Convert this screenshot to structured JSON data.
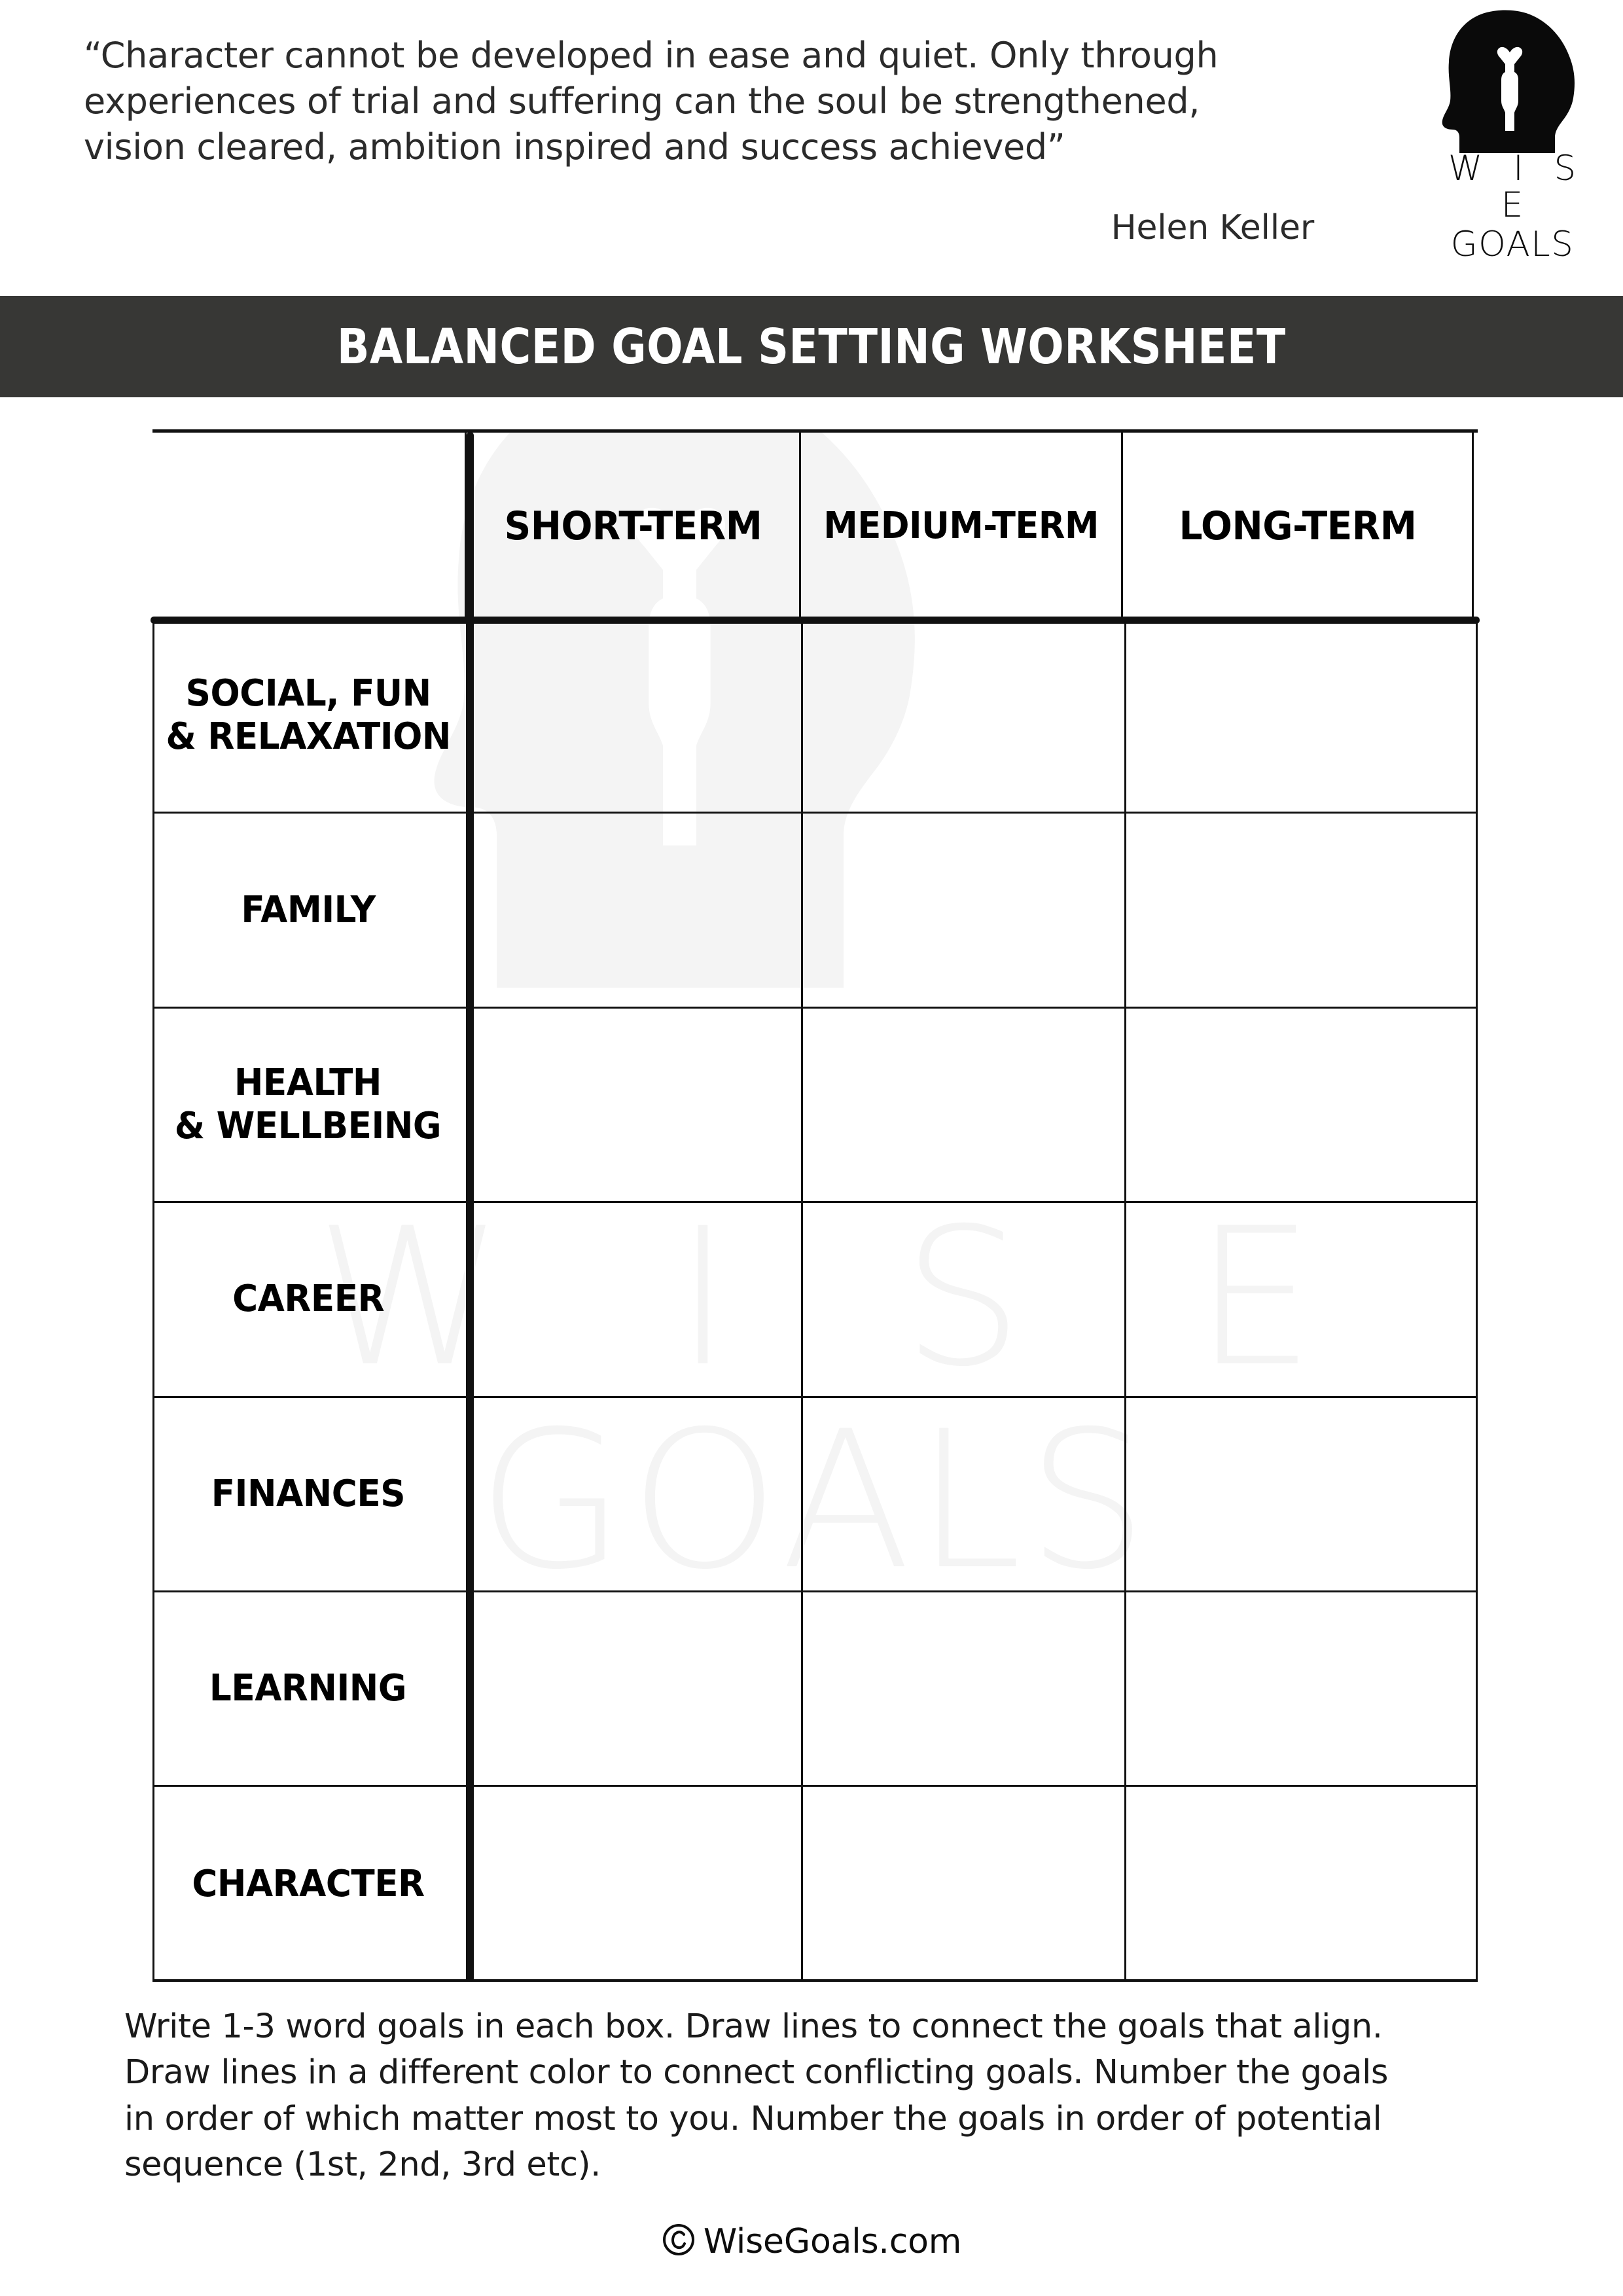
{
  "quote": {
    "text": "“Character cannot be developed in ease and quiet. Only through\nexperiences of trial and suffering can the soul be strengthened,\nvision cleared, ambition inspired and success achieved”",
    "attribution": "Helen Keller"
  },
  "logo": {
    "mark_name": "head-silhouette-with-figure",
    "line1": "W I S E",
    "line2": "GOALS"
  },
  "title_bar": {
    "title": "BALANCED GOAL SETTING WORKSHEET",
    "background": "#373735",
    "text_color": "#ffffff"
  },
  "watermark": {
    "line1": "W I S E",
    "line2": "GOALS",
    "color": "#f4f4f4"
  },
  "table": {
    "corner_label": "",
    "columns": [
      "SHORT-TERM",
      "MEDIUM-TERM",
      "LONG-TERM"
    ],
    "rows": [
      {
        "label": "SOCIAL, FUN\n& RELAXATION",
        "cells": [
          "",
          "",
          ""
        ]
      },
      {
        "label": "FAMILY",
        "cells": [
          "",
          "",
          ""
        ]
      },
      {
        "label": "HEALTH\n& WELLBEING",
        "cells": [
          "",
          "",
          ""
        ]
      },
      {
        "label": "CAREER",
        "cells": [
          "",
          "",
          ""
        ]
      },
      {
        "label": "FINANCES",
        "cells": [
          "",
          "",
          ""
        ]
      },
      {
        "label": "LEARNING",
        "cells": [
          "",
          "",
          ""
        ]
      },
      {
        "label": "CHARACTER",
        "cells": [
          "",
          "",
          ""
        ]
      }
    ]
  },
  "instructions": {
    "text": "Write 1-3 word goals in each box. Draw lines to connect the goals that align.\nDraw lines in a different color to connect conflicting goals. Number the goals\nin order of which matter most to you. Number the goals in order of potential\nsequence (1st, 2nd, 3rd etc)."
  },
  "footer": {
    "copyright_symbol": "©",
    "site": "WiseGoals.com"
  }
}
